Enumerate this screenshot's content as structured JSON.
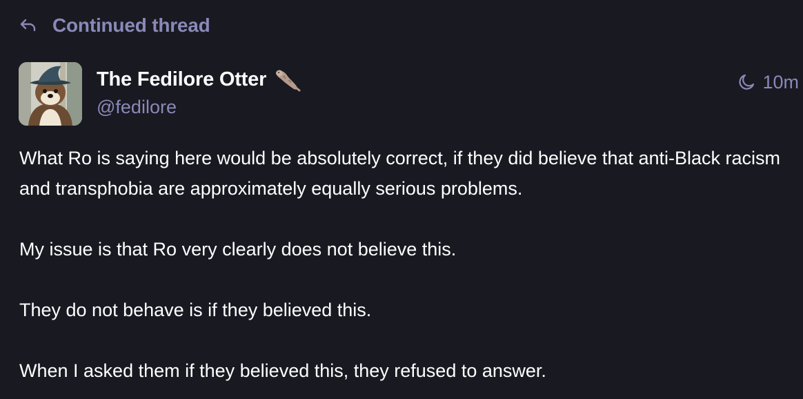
{
  "thread_header": {
    "icon": "reply-arrow-icon",
    "label": "Continued thread"
  },
  "author": {
    "display_name": "The Fedilore Otter",
    "emoji": "otter-emoji",
    "handle": "@fedilore",
    "avatar": "otter-wizard-avatar"
  },
  "meta": {
    "visibility_icon": "moon-icon",
    "timestamp": "10m"
  },
  "post": {
    "paragraphs": [
      "What Ro is saying here would be absolutely correct, if they did believe that anti-Black racism and transphobia are approximately equally serious problems.",
      "My issue is that Ro very clearly does not believe this.",
      "They do not behave is if they believed this.",
      "When I asked them if they believed this, they refused to answer."
    ]
  },
  "colors": {
    "background": "#191922",
    "text": "#ffffff",
    "muted": "#8a89b8"
  }
}
